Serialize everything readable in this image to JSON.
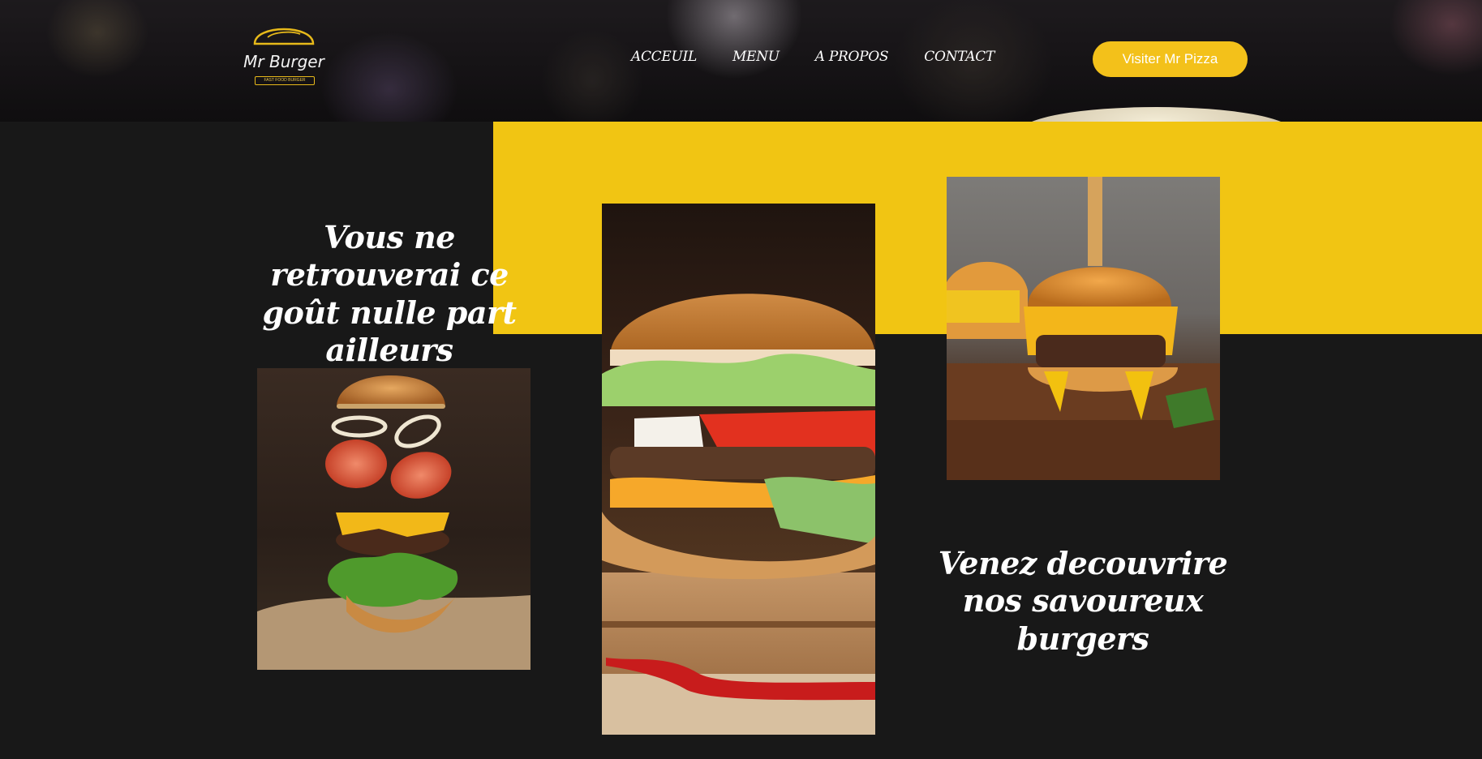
{
  "header": {
    "logo": {
      "name": "Mr Burger",
      "tagline": "FAST FOOD BURGER",
      "accent": "#e7b91a"
    },
    "nav": [
      {
        "label": "ACCEUIL"
      },
      {
        "label": "MENU"
      },
      {
        "label": "A PROPOS"
      },
      {
        "label": "CONTACT"
      }
    ],
    "cta_label": "Visiter Mr Pizza"
  },
  "main": {
    "headline_left": "Vous ne retrouverai ce goût nulle part ailleurs",
    "headline_right": "Venez decouvrire nos savoureux burgers",
    "photos": [
      {
        "subject": "floating deconstructed burger"
      },
      {
        "subject": "tall burger with chili pepper"
      },
      {
        "subject": "burger with melted cheese on board"
      }
    ]
  },
  "colors": {
    "background": "#181818",
    "accent_yellow": "#f1c513",
    "button_yellow": "#f3c11a",
    "text": "#ffffff"
  }
}
